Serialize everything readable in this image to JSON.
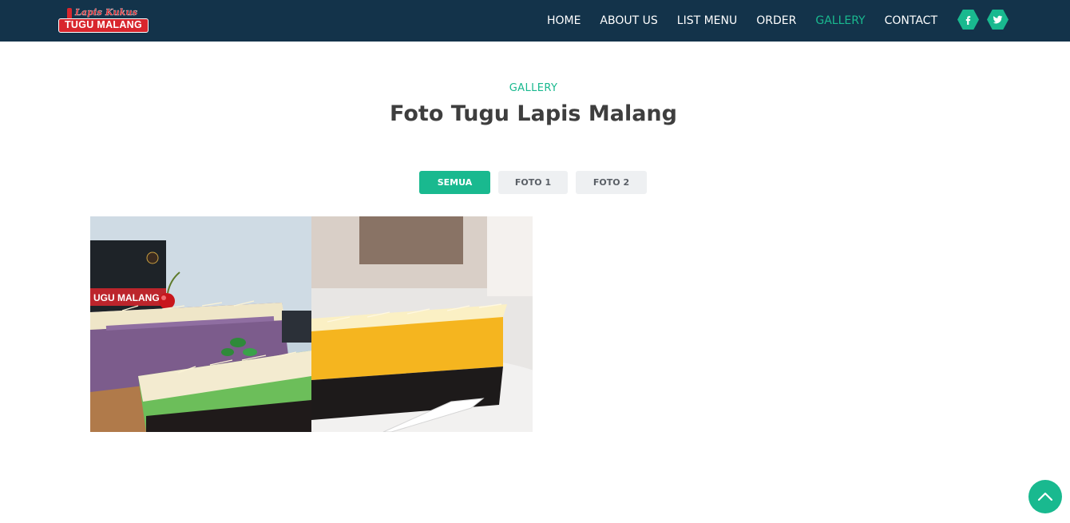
{
  "brand": {
    "logo_top": "Lapis Kukus",
    "logo_main": "TUGU MALANG",
    "colors": {
      "navbar": "#13334a",
      "accent": "#19b98f",
      "logo_red": "#d8262d"
    }
  },
  "nav": {
    "items": [
      {
        "label": "HOME"
      },
      {
        "label": "ABOUT US"
      },
      {
        "label": "LIST MENU"
      },
      {
        "label": "ORDER"
      },
      {
        "label": "GALLERY",
        "active": true
      },
      {
        "label": "CONTACT"
      }
    ],
    "social": [
      {
        "icon": "facebook-icon"
      },
      {
        "icon": "twitter-icon"
      }
    ]
  },
  "section": {
    "tag": "GALLERY",
    "title": "Foto Tugu Lapis Malang"
  },
  "filters": [
    {
      "label": "SEMUA",
      "active": true
    },
    {
      "label": "FOTO 1"
    },
    {
      "label": "FOTO 2"
    }
  ],
  "gallery": {
    "items": [
      {
        "image": "cake-photo-purple-green-lapis"
      },
      {
        "image": "cake-photo-yellow-black-lapis"
      }
    ]
  },
  "back_to_top": {
    "icon": "chevron-up-icon"
  }
}
